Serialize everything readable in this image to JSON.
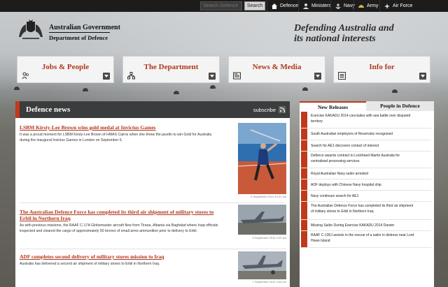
{
  "topbar": {
    "search_placeholder": "Search Defence",
    "search_button": "Search",
    "nav": [
      {
        "label": "Defence",
        "icon": "home-icon"
      },
      {
        "label": "Ministers",
        "icon": "ministers-icon"
      },
      {
        "label": "Navy",
        "icon": "anchor-icon"
      },
      {
        "label": "Army",
        "icon": "army-crest-icon"
      },
      {
        "label": "Air Force",
        "icon": "air-force-icon"
      }
    ]
  },
  "header": {
    "gov_name": "Australian Government",
    "dept_name": "Department of Defence",
    "tagline_line1": "Defending Australia and",
    "tagline_line2": "its national interests"
  },
  "nav_cards": [
    {
      "title": "Jobs & People",
      "icon": "people-icon"
    },
    {
      "title": "The Department",
      "icon": "org-chart-icon"
    },
    {
      "title": "News & Media",
      "icon": "newspaper-icon"
    },
    {
      "title": "Info for",
      "icon": "list-icon"
    }
  ],
  "news": {
    "heading": "Defence news",
    "subscribe": "subscribe",
    "stories": [
      {
        "title": "LSBM Kirsty-Lee Brown wins gold medal at Invictus Games",
        "body_line1": "It was a proud moment for LSBM Kirsty-Lee Brown of HMAS Cairns when she threw the javelin to win Gold for Australia",
        "body_line2": "during the inaugural Invictus Games in London on September 6.",
        "date": "9 September 2014 10:31 am"
      },
      {
        "title_line1": "The Australian Defence Force has completed its third air shipment of military stores to",
        "title_line2": "Erbil in Northern Iraq",
        "body_line1": "As with previous missions, the RAAF C-17A Globemaster aircraft flew from Tirana, Albania via Baghdad where Iraqi officials",
        "body_line2": "inspected and cleared the cargo of approximately 50 tonnes of small arms ammunition prior to delivery to Erbil.",
        "date": "9 September 2014 2:22 am"
      },
      {
        "title": "ADF completes second delivery of military stores mission to Iraq",
        "body_line1": "Australia has delivered a second air shipment of military stores to Erbil in Northern Iraq.",
        "date": "7 September 2014 3:00 pm"
      }
    ]
  },
  "side": {
    "tab_new": "New Releases",
    "tab_people": "People in Defence",
    "releases": [
      {
        "line1": "Exercise KAKADU 2014 concludes with sea battle over disputed",
        "line2": "territory"
      },
      {
        "line1": "South Australian employers of Reservists recognised",
        "line2": ""
      },
      {
        "line1": "Search for AE1 discovers contact of interest",
        "line2": ""
      },
      {
        "line1": "Defence awards contract to Lockheed Martin Australia for",
        "line2": "centralised processing services"
      },
      {
        "line1": "Royal Australian Navy sailor arrested",
        "line2": ""
      },
      {
        "line1": "ADF deploys with Chinese Navy hospital ship",
        "line2": ""
      },
      {
        "line1": "Navy continues search for AE1",
        "line2": ""
      },
      {
        "line1": "The Australian Defence Force has completed its third air shipment",
        "line2": "of military stores to Erbil in Northern Iraq"
      },
      {
        "line1": "Missing Sailor During Exercise KAKADU 2014 Darwin",
        "line2": ""
      },
      {
        "line1": "RAAF C-130J assists in the rescue of a sailor in distress near Lord",
        "line2": "Howe Island"
      }
    ]
  },
  "colors": {
    "accent": "#c0391b",
    "card_title": "#b0361b",
    "topbar": "#1c1c1c",
    "news_header": "#3b3c3e"
  }
}
